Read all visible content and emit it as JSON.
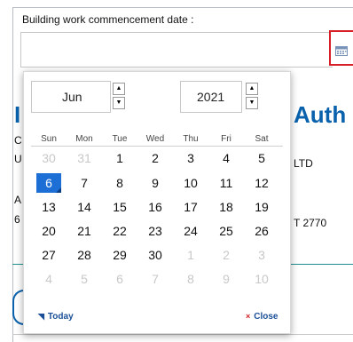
{
  "form": {
    "field_label": "Building work commencement date :",
    "input_value": ""
  },
  "background": {
    "heading_fragment": "Auth",
    "heading_fragment_left": "I",
    "line1_left": "C",
    "line2_left": "U",
    "line2_right": "LTD",
    "line3_left": "A",
    "line4_left": "6",
    "line4_right": "T 2770"
  },
  "datepicker": {
    "month": "Jun",
    "year": "2021",
    "weekdays": [
      "Sun",
      "Mon",
      "Tue",
      "Wed",
      "Thu",
      "Fri",
      "Sat"
    ],
    "weeks": [
      [
        {
          "d": "30",
          "m": true
        },
        {
          "d": "31",
          "m": true
        },
        {
          "d": "1"
        },
        {
          "d": "2"
        },
        {
          "d": "3"
        },
        {
          "d": "4"
        },
        {
          "d": "5"
        }
      ],
      [
        {
          "d": "6",
          "s": true
        },
        {
          "d": "7"
        },
        {
          "d": "8"
        },
        {
          "d": "9"
        },
        {
          "d": "10"
        },
        {
          "d": "11"
        },
        {
          "d": "12"
        }
      ],
      [
        {
          "d": "13"
        },
        {
          "d": "14"
        },
        {
          "d": "15"
        },
        {
          "d": "16"
        },
        {
          "d": "17"
        },
        {
          "d": "18"
        },
        {
          "d": "19"
        }
      ],
      [
        {
          "d": "20"
        },
        {
          "d": "21"
        },
        {
          "d": "22"
        },
        {
          "d": "23"
        },
        {
          "d": "24"
        },
        {
          "d": "25"
        },
        {
          "d": "26"
        }
      ],
      [
        {
          "d": "27"
        },
        {
          "d": "28"
        },
        {
          "d": "29"
        },
        {
          "d": "30"
        },
        {
          "d": "1",
          "m": true
        },
        {
          "d": "2",
          "m": true
        },
        {
          "d": "3",
          "m": true
        }
      ],
      [
        {
          "d": "4",
          "m": true
        },
        {
          "d": "5",
          "m": true
        },
        {
          "d": "6",
          "m": true
        },
        {
          "d": "7",
          "m": true
        },
        {
          "d": "8",
          "m": true
        },
        {
          "d": "9",
          "m": true
        },
        {
          "d": "10",
          "m": true
        }
      ]
    ],
    "selected_date": "6",
    "today_label": "Today",
    "close_label": "Close",
    "spin_up": "▲",
    "spin_down": "▼",
    "today_icon": "◥",
    "close_icon": "×"
  },
  "colors": {
    "selected_bg": "#1d6fd6",
    "heading": "#0a62ad",
    "calendar_button_border": "#d61f26",
    "close_icon": "#d12020"
  },
  "icons": [
    "calendar-icon",
    "chevron-up-icon",
    "chevron-down-icon",
    "today-icon",
    "close-icon"
  ]
}
